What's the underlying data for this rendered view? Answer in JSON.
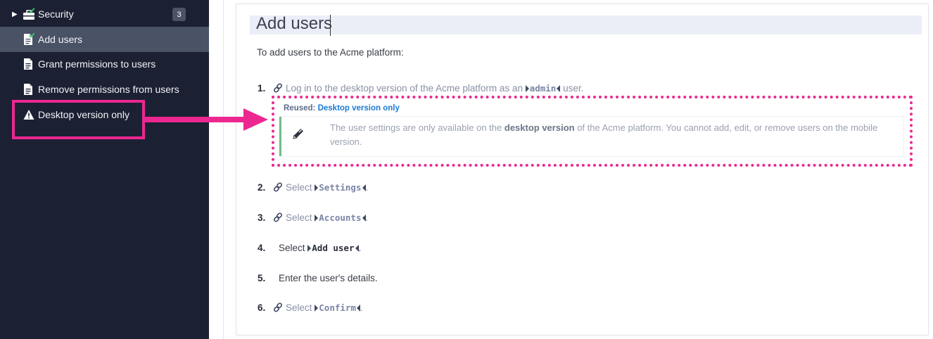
{
  "sidebar": {
    "items": [
      {
        "label": "Security",
        "badge": "3",
        "icon": "toolbox-check-icon"
      },
      {
        "label": "Add users",
        "icon": "document-check-icon"
      },
      {
        "label": "Grant permissions to users",
        "icon": "document-icon"
      },
      {
        "label": "Remove permissions from users",
        "icon": "document-icon"
      },
      {
        "label": "Desktop version only",
        "icon": "warning-icon"
      }
    ]
  },
  "main": {
    "title": "Add users",
    "intro": "To add users to the Acme platform:",
    "steps": [
      {
        "num": "1.",
        "pre": "Log in to the desktop version of the Acme platform as an ",
        "cmd": "admin",
        "post": " user."
      },
      {
        "num": "2.",
        "pre": "Select ",
        "cmd": "Settings",
        "post": "."
      },
      {
        "num": "3.",
        "pre": "Select ",
        "cmd": "Accounts",
        "post": "."
      },
      {
        "num": "4.",
        "pre": "Select ",
        "cmd": "Add user",
        "post": "."
      },
      {
        "num": "5.",
        "text": "Enter the user's details."
      },
      {
        "num": "6.",
        "pre": "Select ",
        "cmd": "Confirm",
        "post": "."
      }
    ],
    "reuse": {
      "prefix": "Reused:",
      "title": "Desktop version only",
      "note_pre": "The user settings are only available on the ",
      "note_bold": "desktop version",
      "note_post": " of the Acme platform. You cannot add, edit, or remove users on the mobile version."
    }
  },
  "colors": {
    "sidebar_bg": "#1c2033",
    "highlight": "#ec2790",
    "link_blue": "#1a7bd5",
    "note_border": "#6fbf8a"
  }
}
